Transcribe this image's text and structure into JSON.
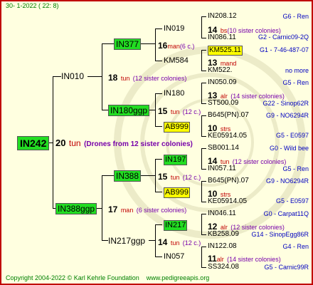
{
  "header": {
    "date": "30-  1-2022 (  22:  8)"
  },
  "root": {
    "code": "IN242",
    "year": "20",
    "relation": "tun",
    "note": "(Drones from 12 sister colonies)"
  },
  "sire_branch": {
    "code": "IN010",
    "year": "18",
    "relation": "tun",
    "note": "(12 sister colonies)",
    "p1": {
      "code": "IN377",
      "year": "16",
      "relation": "man",
      "note": "(6 c.)",
      "a": {
        "code": "IN019",
        "year": "14",
        "relation": "bs",
        "note": "(10 sister colonies)",
        "a": {
          "code": "IN208.12",
          "right": "G6 - Ren"
        },
        "b": {
          "code": "IN086.11",
          "right": "G2 - Carnic09-2Q"
        }
      },
      "b": {
        "code": "KM584",
        "year": "13",
        "relation": "mand",
        "a": {
          "code": "KM525.11",
          "right": "G1 - 7-46-487-07"
        },
        "b": {
          "code": "KM522.",
          "right": "no more"
        }
      }
    },
    "p2": {
      "code": "IN180ggp",
      "year": "15",
      "relation": "tun",
      "note": "(12 c.)",
      "a": {
        "code": "IN180",
        "year": "13",
        "relation": "alr",
        "note": "(14 sister colonies)",
        "a": {
          "code": "IN050.09",
          "right": "G5 - Ren"
        },
        "b": {
          "code": "ST500.09",
          "right": "G22 - Sinop62R"
        }
      },
      "b": {
        "code": "AB999",
        "year": "10",
        "relation": "strs",
        "a": {
          "code": "B645(PN).07",
          "right": "G9 - NO6294R"
        },
        "b": {
          "code": "KE05914.05",
          "right": "G5 - E0597"
        }
      }
    }
  },
  "dam_branch": {
    "code": "IN388ggp",
    "year": "17",
    "relation": "man",
    "note": "(6 sister colonies)",
    "p1": {
      "code": "IN388",
      "year": "15",
      "relation": "tun",
      "note": "(12 c.)",
      "a": {
        "code": "IN197",
        "year": "14",
        "relation": "tun",
        "note": "(12 sister colonies)",
        "a": {
          "code": "SB001.14",
          "right": "G0 - Wild bee"
        },
        "b": {
          "code": "IN057.11",
          "right": "G5 - Ren"
        }
      },
      "b": {
        "code": "AB999",
        "year": "10",
        "relation": "strs",
        "a": {
          "code": "B645(PN).07",
          "right": "G9 - NO6294R"
        },
        "b": {
          "code": "KE05914.05",
          "right": "G5 - E0597"
        }
      }
    },
    "p2": {
      "code": "IN217ggp",
      "year": "14",
      "relation": "tun",
      "note": "(12 c.)",
      "a": {
        "code": "IN217",
        "year": "12",
        "relation": "alr",
        "note": "(12 sister colonies)",
        "a": {
          "code": "IN046.11",
          "right": "G0 - Carpat11Q"
        },
        "b": {
          "code": "KB258.09",
          "right": "G14 - SinopEgg86R"
        }
      },
      "b": {
        "code": "IN057",
        "year": "11",
        "relation": "alr",
        "note": "(14 sister colonies)",
        "a": {
          "code": "IN122.08",
          "right": "G4 - Ren"
        },
        "b": {
          "code": "SS324.08",
          "right": "G5 - Carnic99R"
        }
      }
    }
  },
  "footer": {
    "copyright": "Copyright 2004-2022 © Karl Kehrle Foundation",
    "site": "www.pedigreeapis.org"
  },
  "colors": {
    "frame": "#c00000",
    "box_green": "#22dd22",
    "box_yellow": "#ffff00",
    "relation": "#c00000",
    "note": "#7700aa",
    "right": "#0000c0",
    "footer": "#008000"
  }
}
